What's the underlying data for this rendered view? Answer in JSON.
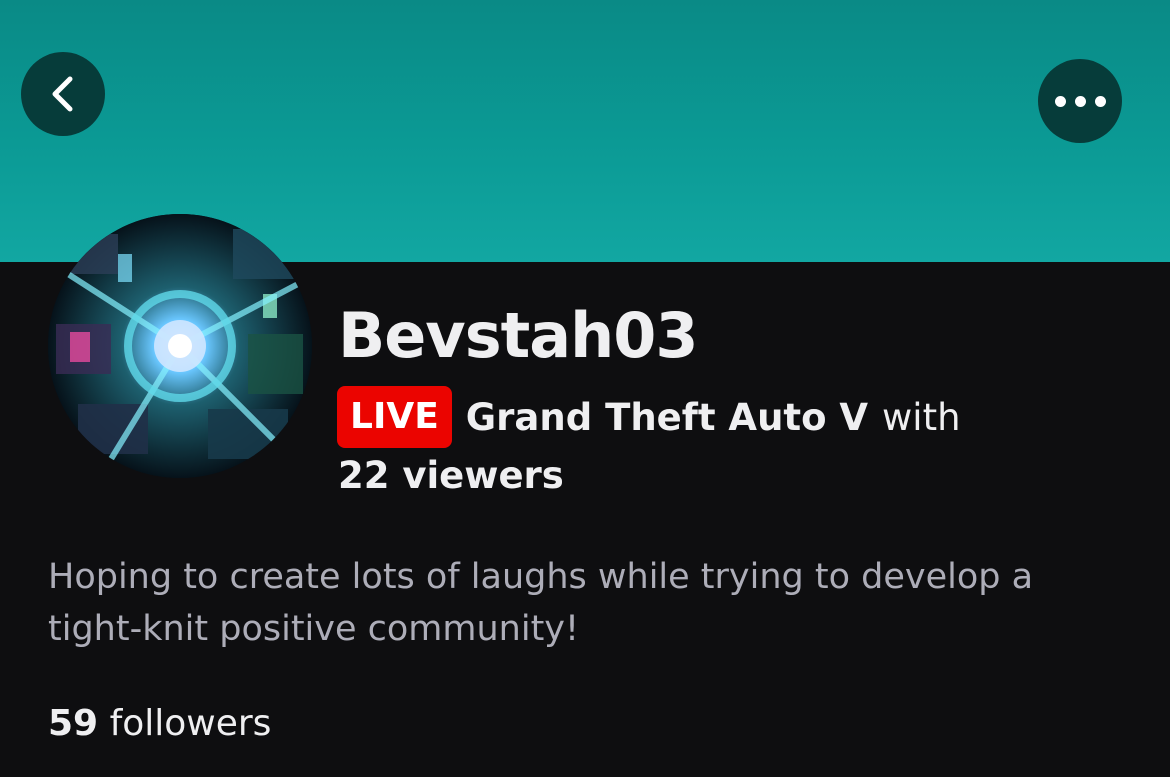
{
  "header": {
    "back_icon": "chevron-left-icon",
    "more_icon": "more-horizontal-icon",
    "banner_color": "#0b9a95"
  },
  "profile": {
    "avatar_icon": "channel-avatar",
    "username": "Bevstah03",
    "live_badge": "LIVE",
    "live_color": "#eb0400",
    "game": "Grand Theft Auto V",
    "with_text": "with",
    "viewers": "22 viewers",
    "bio": "Hoping to create lots of laughs while trying to develop a tight-knit positive community!",
    "followers_count": "59",
    "followers_label": "followers"
  }
}
